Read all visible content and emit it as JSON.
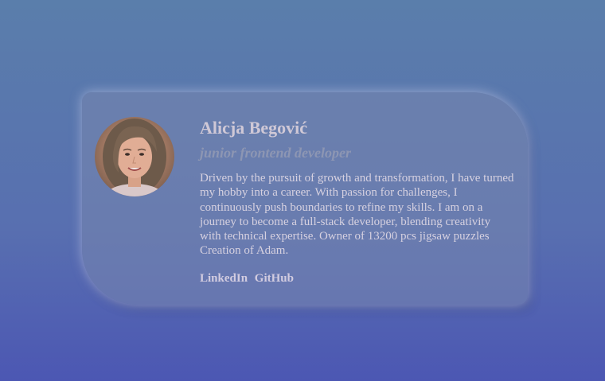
{
  "profile": {
    "name": "Alicja Begović",
    "role": "junior frontend developer",
    "bio": "Driven by the pursuit of growth and transformation, I have turned my hobby into a career. With passion for challenges, I continuously push boundaries to refine my skills. I am on a journey to become a full-stack developer, blending creativity with technical expertise. Owner of 13200 pcs jigsaw puzzles Creation of Adam.",
    "links": [
      {
        "label": "LinkedIn"
      },
      {
        "label": "GitHub"
      }
    ]
  },
  "colors": {
    "background_top": "#5a7eab",
    "background_bottom": "#4c57b3",
    "name_text": "#cfc8d6",
    "role_text": "#8d96b3"
  }
}
